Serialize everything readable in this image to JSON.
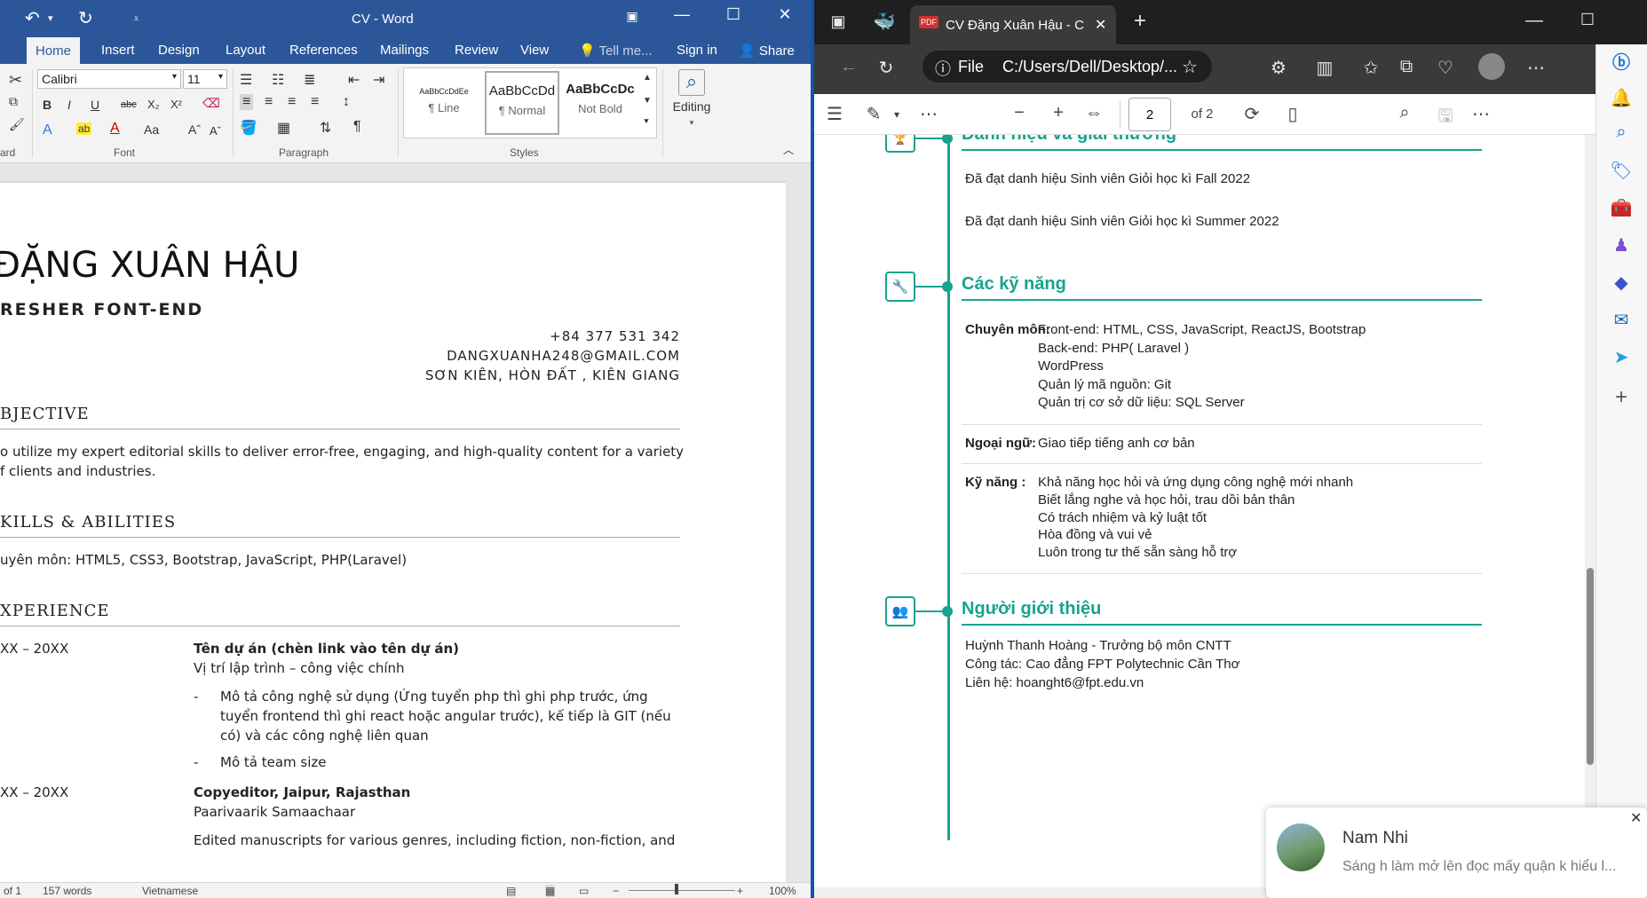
{
  "word": {
    "title": "CV - Word",
    "sign_in": "Sign in",
    "share": "Share",
    "tabs": [
      "Home",
      "Insert",
      "Design",
      "Layout",
      "References",
      "Mailings",
      "Review",
      "View"
    ],
    "tell_me": "Tell me...",
    "ribbon": {
      "font_name": "Calibri",
      "font_size": "11",
      "group_clipboard": "ard",
      "group_font": "Font",
      "group_paragraph": "Paragraph",
      "group_styles": "Styles",
      "styles": [
        {
          "preview": "AaBbCcDdEe",
          "label": "¶ Line"
        },
        {
          "preview": "AaBbCcDd",
          "label": "¶ Normal"
        },
        {
          "preview": "AaBbCcDc",
          "label": "Not Bold"
        }
      ],
      "editing": "Editing"
    },
    "doc": {
      "name": "ĐẶNG XUÂN HẬU",
      "role": "RESHER FONT-END",
      "phone": "+84 377 531 342",
      "email": "DANGXUANHA248@GMAIL.COM",
      "address": "SƠN KIÊN, HÒN ĐẤT , KIÊN GIANG",
      "objective_h": "BJECTIVE",
      "objective_1": "o utilize my expert editorial skills to deliver error-free, engaging, and high-quality content for a variety",
      "objective_2": "f clients and industries.",
      "skills_h": "KILLS & ABILITIES",
      "skills_1": "uyên môn: HTML5, CSS3, Bootstrap, JavaScript, PHP(Laravel)",
      "exp_h": "XPERIENCE",
      "exp1_date": "XX – 20XX",
      "exp1_title": "Tên dự án (chèn link vào tên dự án)",
      "exp1_sub": "Vị trí lập trình – công việc chính",
      "exp1_b1_1": "Mô tả công nghệ sử dụng (Ứng tuyển php thì ghi php trước, ứng",
      "exp1_b1_2": "tuyển frontend thì ghi react hoặc angular trước), kế tiếp là GIT (nếu",
      "exp1_b1_3": "có) và các công nghệ liên quan",
      "exp1_b2": "Mô tả team size",
      "exp2_date": "XX – 20XX",
      "exp2_title": "Copyeditor, Jaipur, Rajasthan",
      "exp2_sub": "Paarivaarik Samaachaar",
      "exp2_txt": "Edited manuscripts for various genres, including fiction, non-fiction, and"
    },
    "status": {
      "page": "of 1",
      "words": "157 words",
      "lang": "Vietnamese",
      "zoom": "100%"
    }
  },
  "edge": {
    "tab_title": "CV Đặng Xuân Hậu - CV Đặng Xu",
    "url_label": "File",
    "url": "C:/Users/Dell/Desktop/...",
    "page_current": "2",
    "page_total": "of 2",
    "pdf": {
      "s1_title": "Danh hiệu và giải thưởng",
      "s1_l1": "Đã đạt danh hiệu Sinh viên Giỏi  học kì Fall 2022",
      "s1_l2": "Đã đạt danh hiệu Sinh viên Giỏi học kì Summer 2022",
      "s2_title": "Các kỹ năng",
      "skill_label_1": "Chuyên môn:",
      "skill_items_1": [
        "Front-end: HTML, CSS, JavaScript, ReactJS, Bootstrap",
        "Back-end: PHP( Laravel )",
        "WordPress",
        "Quản lý mã nguồn: Git",
        "Quản trị cơ sở dữ liệu: SQL Server"
      ],
      "skill_label_2": "Ngoại ngữ:",
      "skill_items_2": [
        "Giao tiếp tiếng anh cơ bản"
      ],
      "skill_label_3": "Kỹ năng :",
      "skill_items_3": [
        "Khả năng học hỏi và ứng dụng công nghệ mới nhanh",
        "Biết lắng nghe và học hỏi, trau dồi bản thân",
        "Có trách nhiệm và kỷ luật tốt",
        "Hòa đồng và vui vẻ",
        "Luôn trong tư thế sẵn sàng hỗ trợ"
      ],
      "s3_title": "Người giới thiệu",
      "ref_1": "Huỳnh Thanh Hoàng - Trưởng bộ môn CNTT",
      "ref_2": "Công tác: Cao đẳng FPT Polytechnic Cần Thơ",
      "ref_3": "Liên hệ: hoanght6@fpt.edu.vn"
    }
  },
  "notification": {
    "sender": "Nam Nhi",
    "message": "Sáng h làm mở lên đọc mấy quận k hiểu l..."
  },
  "colors": {
    "word_blue": "#2b579a",
    "accent_teal": "#17a38e",
    "edge_dark": "#1f1f1f"
  }
}
